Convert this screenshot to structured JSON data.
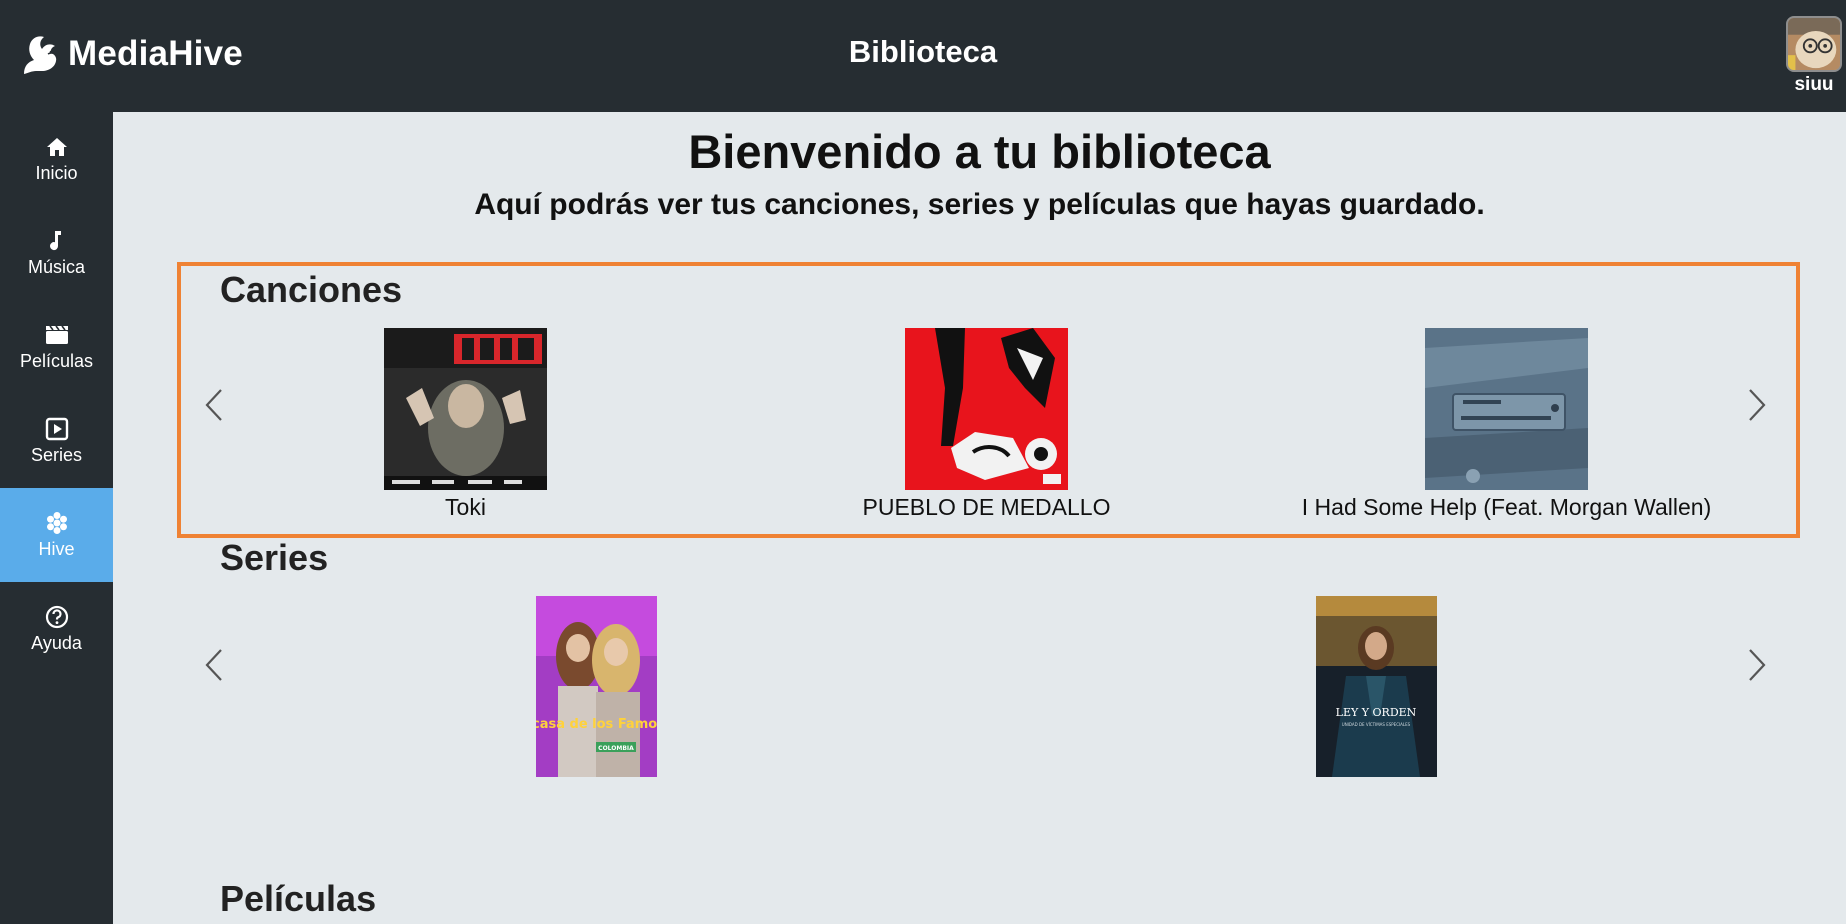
{
  "header": {
    "brand_name": "MediaHive",
    "page_title": "Biblioteca",
    "username": "siuu"
  },
  "sidebar": {
    "items": [
      {
        "label": "Inicio",
        "icon": "home-icon"
      },
      {
        "label": "Música",
        "icon": "music-note-icon"
      },
      {
        "label": "Películas",
        "icon": "clapperboard-icon"
      },
      {
        "label": "Series",
        "icon": "play-square-icon"
      },
      {
        "label": "Hive",
        "icon": "hive-cluster-icon",
        "active": true
      },
      {
        "label": "Ayuda",
        "icon": "help-circle-icon"
      }
    ]
  },
  "main": {
    "welcome_title": "Bienvenido a tu biblioteca",
    "welcome_subtitle": "Aquí podrás ver tus canciones, series y películas que hayas guardado.",
    "sections": {
      "songs": {
        "heading": "Canciones",
        "items": [
          {
            "title": "Toki"
          },
          {
            "title": "PUEBLO DE MEDALLO"
          },
          {
            "title": "I Had Some Help (Feat. Morgan Wallen)"
          }
        ]
      },
      "series": {
        "heading": "Series",
        "items": [
          {
            "poster_text": "La casa de los Famosos",
            "poster_sub": "COLOMBIA"
          },
          {
            "poster_text": "LEY Y ORDEN",
            "poster_sub": "UNIDAD DE VÍCTIMAS ESPECIALES"
          }
        ]
      },
      "movies": {
        "heading": "Películas"
      }
    }
  },
  "colors": {
    "topbar": "#262d32",
    "background": "#e4e9ec",
    "active_nav": "#5aacea",
    "highlight_border": "#ef8234"
  }
}
